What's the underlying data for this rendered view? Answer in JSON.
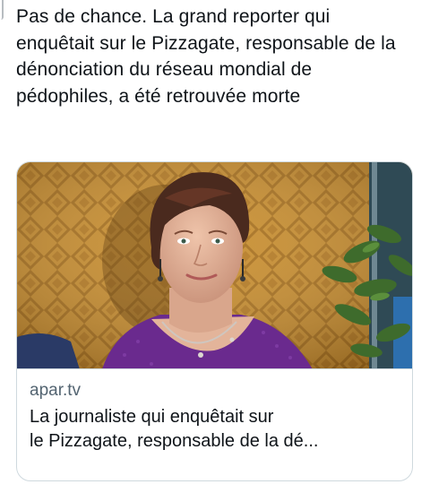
{
  "tweet": {
    "text": "Pas de chance. La grand reporter qui enquêtait sur le Pizzagate, responsable de la dénonciation du réseau mondial de pédophiles, a été retrouvée morte"
  },
  "link_card": {
    "domain": "apar.tv",
    "title": "La journaliste qui enquêtait sur\nle Pizzagate, responsable de la dé...",
    "image": {
      "subject": "woman-portrait",
      "colors": {
        "background_wall": "#c98e2e",
        "wall_pattern": "#a8701c",
        "hair": "#4a2a1e",
        "skin": "#e3b49a",
        "top": "#6a2a8e",
        "plant": "#3e6b2c",
        "window": "#2f4a55"
      }
    }
  },
  "theme": {
    "text_color": "#0f1419",
    "secondary_text_color": "#536471",
    "border_color": "#cfd9de"
  }
}
